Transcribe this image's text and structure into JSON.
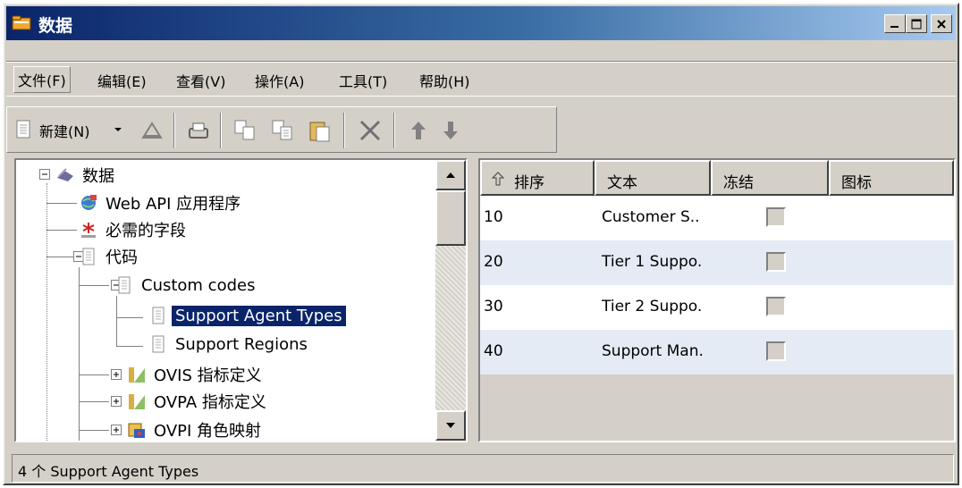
{
  "window": {
    "title": "数据"
  },
  "menu": {
    "items": [
      "文件(F)",
      "编辑(E)",
      "查看(V)",
      "操作(A)",
      "工具(T)",
      "帮助(H)"
    ]
  },
  "toolbar": {
    "new_label": "新建(N)"
  },
  "tree": {
    "nodes": [
      {
        "label": "数据",
        "icon": "data-root-icon"
      },
      {
        "label": "Web API 应用程序",
        "icon": "web-api-icon"
      },
      {
        "label": "必需的字段",
        "icon": "required-field-icon"
      },
      {
        "label": "代码",
        "icon": "codes-icon"
      },
      {
        "label": "Custom codes",
        "icon": "codes-icon"
      },
      {
        "label": "Support Agent Types",
        "icon": "codes-icon",
        "selected": true
      },
      {
        "label": "Support Regions",
        "icon": "codes-icon"
      },
      {
        "label": "OVIS 指标定义",
        "icon": "folder-icon"
      },
      {
        "label": "OVPA 指标定义",
        "icon": "folder-icon"
      },
      {
        "label": "OVPI 角色映射",
        "icon": "role-map-icon"
      }
    ]
  },
  "list": {
    "columns": [
      "排序",
      "文本",
      "冻结",
      "图标"
    ],
    "rows": [
      {
        "order": "10",
        "text": "Customer S..",
        "frozen": false
      },
      {
        "order": "20",
        "text": "Tier 1 Suppo.",
        "frozen": false
      },
      {
        "order": "30",
        "text": "Tier 2 Suppo.",
        "frozen": false
      },
      {
        "order": "40",
        "text": "Support Man.",
        "frozen": false
      }
    ]
  },
  "status": {
    "text": "4 个 Support Agent Types"
  },
  "colors": {
    "title_start": "#0a246a",
    "title_end": "#a6caf0",
    "selection": "#0a246a",
    "row_alt": "#e4ebf5",
    "face": "#d4d0c8"
  }
}
